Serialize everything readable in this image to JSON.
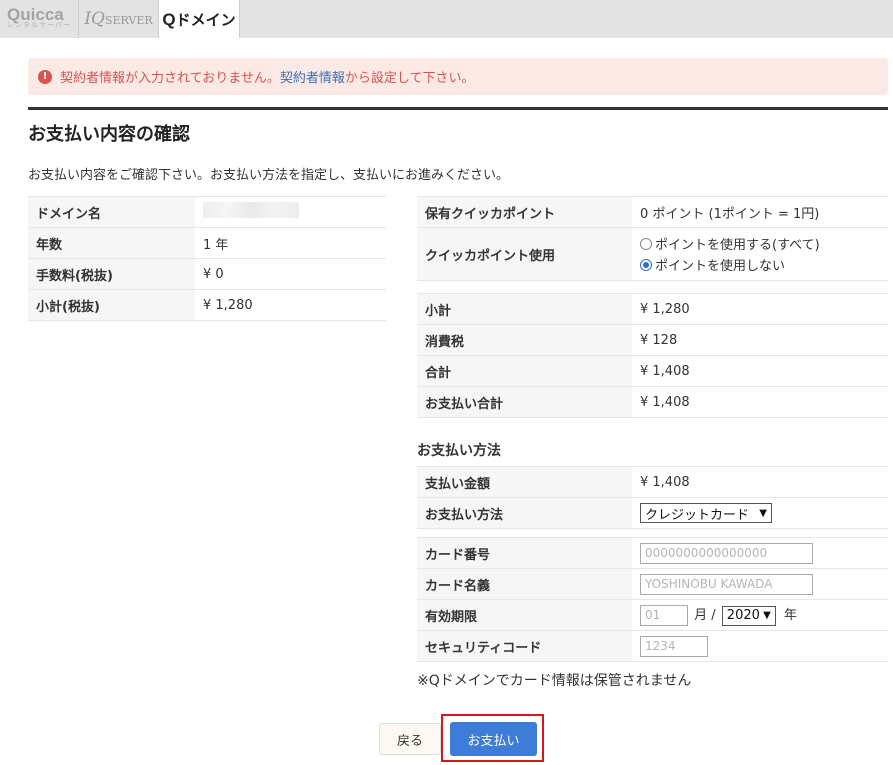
{
  "tabs": [
    {
      "label": "Quicca",
      "sub": "レンタルサーバー"
    },
    {
      "label_main": "IQ",
      "label_sub": "SERVER"
    },
    {
      "label_q": "Q",
      "label_rest": "ドメイン"
    }
  ],
  "alert": {
    "icon": "exclamation-circle-icon",
    "text_before": "契約者情報が入力されておりません。",
    "link": "契約者情報",
    "text_after": "から設定して下さい。",
    "color": "#d9534f"
  },
  "page": {
    "title": "お支払い内容の確認",
    "lead": "お支払い内容をご確認下さい。お支払い方法を指定し、支払いにお進みください。"
  },
  "left_table": [
    {
      "label": "ドメイン名",
      "value": ""
    },
    {
      "label": "年数",
      "value": "1 年"
    },
    {
      "label": "手数料(税抜)",
      "value": "¥ 0"
    },
    {
      "label": "小計(税抜)",
      "value": "¥ 1,280"
    }
  ],
  "points": {
    "held_label": "保有クイッカポイント",
    "held_value": "0 ポイント (1ポイント = 1円)",
    "use_label": "クイッカポイント使用",
    "option_use": "ポイントを使用する(すべて)",
    "option_nouse": "ポイントを使用しない",
    "selected": "ポイントを使用しない"
  },
  "totals": [
    {
      "label": "小計",
      "value": "¥ 1,280"
    },
    {
      "label": "消費税",
      "value": "¥ 128"
    },
    {
      "label": "合計",
      "value": "¥ 1,408"
    },
    {
      "label": "お支払い合計",
      "value": "¥ 1,408"
    }
  ],
  "payment": {
    "section_title": "お支払い方法",
    "amount_label": "支払い金額",
    "amount_value": "¥ 1,408",
    "method_label": "お支払い方法",
    "method_value": "クレジットカード"
  },
  "card": {
    "number_label": "カード番号",
    "number_placeholder": "0000000000000000",
    "name_label": "カード名義",
    "name_placeholder": "YOSHINOBU KAWADA",
    "expiry_label": "有効期限",
    "month_placeholder": "01",
    "month_unit": "月 /",
    "year_value": "2020",
    "year_unit": "年",
    "cvc_label": "セキュリティコード",
    "cvc_placeholder": "1234"
  },
  "note": "※Qドメインでカード情報は保管されません",
  "buttons": {
    "back": "戻る",
    "pay": "お支払い",
    "pay_color": "#3e7dd7"
  }
}
